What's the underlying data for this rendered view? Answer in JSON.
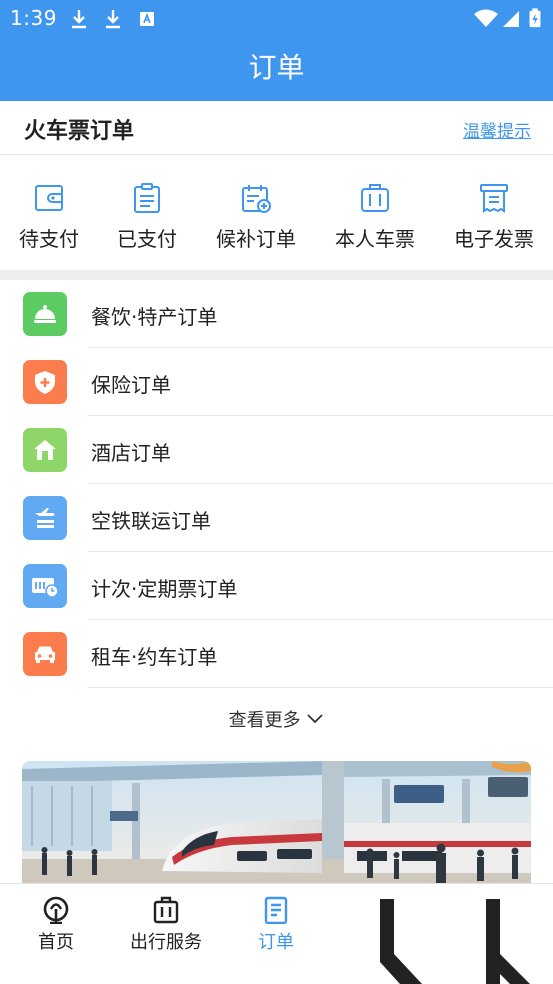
{
  "status_bar": {
    "time": "1:39"
  },
  "header": {
    "title": "订单"
  },
  "section": {
    "title": "火车票订单",
    "tips_link": "温馨提示"
  },
  "quick_actions": [
    {
      "label": "待支付",
      "icon": "wallet-icon"
    },
    {
      "label": "已支付",
      "icon": "clipboard-icon"
    },
    {
      "label": "候补订单",
      "icon": "calendar-add-icon"
    },
    {
      "label": "本人车票",
      "icon": "luggage-icon"
    },
    {
      "label": "电子发票",
      "icon": "receipt-icon"
    }
  ],
  "order_list": [
    {
      "label": "餐饮·特产订单",
      "icon": "food-bell-icon",
      "color": "#5ccc62"
    },
    {
      "label": "保险订单",
      "icon": "shield-plus-icon",
      "color": "#fb7d4e"
    },
    {
      "label": "酒店订单",
      "icon": "hotel-house-icon",
      "color": "#8ed668"
    },
    {
      "label": "空铁联运订单",
      "icon": "plane-train-icon",
      "color": "#62a9f3"
    },
    {
      "label": "计次·定期票订单",
      "icon": "ticket-clock-icon",
      "color": "#62a9f3"
    },
    {
      "label": "租车·约车订单",
      "icon": "car-icon",
      "color": "#fb7d4e"
    }
  ],
  "more": {
    "label": "查看更多"
  },
  "bottom_nav": [
    {
      "label": "首页",
      "icon": "railway-logo-icon",
      "active": false
    },
    {
      "label": "出行服务",
      "icon": "suitcase-icon",
      "active": false
    },
    {
      "label": "订单",
      "icon": "order-doc-icon",
      "active": true
    }
  ],
  "colors": {
    "primary": "#3f96ee",
    "divider": "#e8e8e8",
    "section_gap": "#eeeeee"
  }
}
